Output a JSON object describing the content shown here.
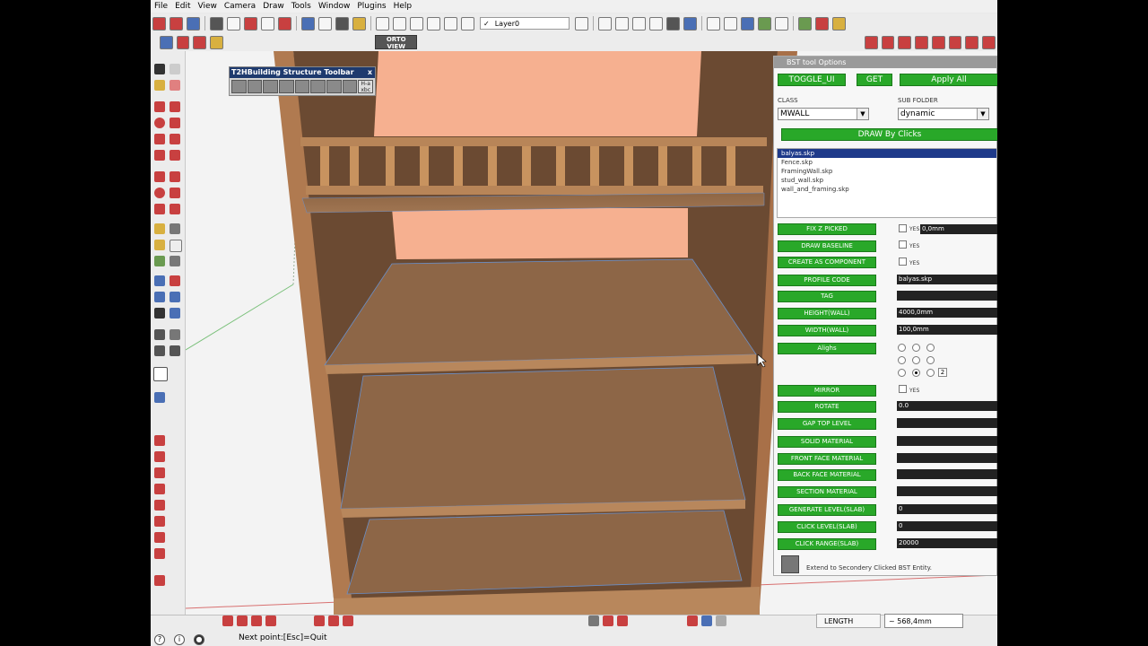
{
  "menu": [
    "File",
    "Edit",
    "View",
    "Camera",
    "Draw",
    "Tools",
    "Window",
    "Plugins",
    "Help"
  ],
  "layer": {
    "check": "✓",
    "name": "Layer0"
  },
  "ortho": {
    "line1": "ORTO",
    "line2": "VIEW"
  },
  "floating_toolbar": {
    "title": "T2HBuilding Structure Toolbar",
    "close": "x",
    "last_icon_line1": "H-a",
    "last_icon_line2": "xbc"
  },
  "status": {
    "text": "Next point:[Esc]=Quit",
    "length_label": "LENGTH",
    "length_value": "~ 568,4mm"
  },
  "panel": {
    "title": "BST tool Options",
    "toggle": "TOGGLE_UI",
    "get": "GET",
    "apply_all": "Apply All",
    "class_label": "CLASS",
    "class_value": "MWALL",
    "subfolder_label": "SUB FOLDER",
    "subfolder_value": "dynamic",
    "draw_by_clicks": "DRAW By Clicks",
    "files": [
      "balyas.skp",
      "Fence.skp",
      "FramingWall.skp",
      "stud_wall.skp",
      "wall_and_framing.skp"
    ],
    "yes": "YES",
    "rows": {
      "fix_z": {
        "label": "FIX Z PICKED",
        "value": "0,0mm"
      },
      "baseline": {
        "label": "DRAW BASELINE"
      },
      "component": {
        "label": "CREATE AS COMPONENT"
      },
      "profile": {
        "label": "PROFILE CODE",
        "value": "balyas.skp"
      },
      "tag": {
        "label": "TAG",
        "value": ""
      },
      "height": {
        "label": "HEIGHT(WALL)",
        "value": "4000,0mm"
      },
      "width": {
        "label": "WIDTH(WALL)",
        "value": "100,0mm"
      },
      "align": {
        "label": "Alighs",
        "number": "2"
      },
      "mirror": {
        "label": "MIRROR"
      },
      "rotate": {
        "label": "ROTATE",
        "value": "0.0"
      },
      "gap_top": {
        "label": "GAP TOP LEVEL",
        "value": ""
      },
      "solid_mat": {
        "label": "SOLID MATERIAL",
        "value": ""
      },
      "front_mat": {
        "label": "FRONT FACE MATERIAL",
        "value": ""
      },
      "back_mat": {
        "label": "BACK FACE MATERIAL",
        "value": ""
      },
      "section_mat": {
        "label": "SECTION MATERIAL",
        "value": ""
      },
      "gen_level": {
        "label": "GENERATE LEVEL(SLAB)",
        "value": "0"
      },
      "click_level": {
        "label": "CLICK LEVEL(SLAB)",
        "value": "0"
      },
      "click_range": {
        "label": "CLICK RANGE(SLAB)",
        "value": "20000"
      }
    },
    "extend_text": "Extend to Secondery Clicked BST Entity."
  }
}
